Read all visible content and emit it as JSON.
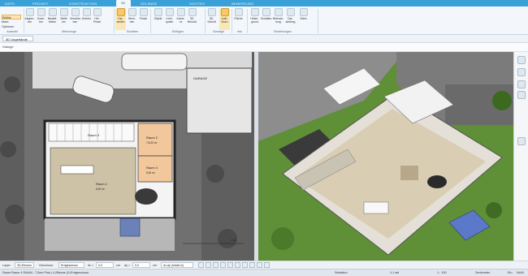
{
  "tabs": [
    "DATEI",
    "PROJEKT",
    "KONSTRUKTION",
    "3D",
    "GELÄNDE",
    "SICHTEN",
    "BEMERKUNG"
  ],
  "left_column": [
    "Wähle",
    "Mark.",
    "Optionen"
  ],
  "ribbon_buttons": [
    "Abgren- zen",
    "Zoom- ten",
    "Bauteil- beiten",
    "Stelle ren",
    "Verschie- ben",
    "Drehen",
    "Hin- Pinsel",
    "Dar- stellen",
    "Rech- nen",
    "Pinsel",
    "Objekt",
    "Licht- quelle",
    "Kame- ra",
    "3D- Bemaß",
    "3D- Schnitt",
    "Aufk- lösen",
    "Fläche",
    "Hinter- grund",
    "Schatten",
    "Beleuch- tung",
    "Dar- stellung",
    "Video"
  ],
  "ribbon_groups": [
    "Auswahl",
    "Werkzeuge",
    "Schatten",
    "Einfügen",
    "Sonstige",
    "Info",
    "Einstellungen"
  ],
  "viewbar": {
    "dropdown": "3D  Ungerlände"
  },
  "dialog_label": "Dialoge",
  "plan": {
    "garage_label": "GARAGE",
    "rooms": [
      "Raum 2",
      "Raum 3",
      "Raum 4",
      "Raum 1"
    ],
    "room_areas": [
      "7,6,00 m²",
      "5,00 m²",
      "5,00 m²"
    ],
    "dimension": "4,55"
  },
  "layerbar": {
    "layer_label": "Layer:",
    "layer_value": "3D-Elemen",
    "floor_label": "Geschoss:",
    "floor_value": "Erdgeschoss",
    "dx_label": "dx =",
    "dx_value": "0,0",
    "cm1": "cm",
    "dy_label": "dy =",
    "dy_value": "0,0",
    "cm2": "cm",
    "extra_value": "dx,dy (relativ in)"
  },
  "status": {
    "left": "Raum Raum 4 RAUM - 7,5cm Putz | 4-Räume |G-Erdgeschoss",
    "selection": "Selektion",
    "count": "1:1 sel",
    "ratio": "1 : 100",
    "units": "Zentimeter",
    "mode": "Ein",
    "num": "NUM"
  },
  "colors": {
    "accent": "#3aa1d8",
    "ribbon": "#f3f7fb",
    "grass": "#5e8d35",
    "highlight": "#fbe7b5"
  }
}
